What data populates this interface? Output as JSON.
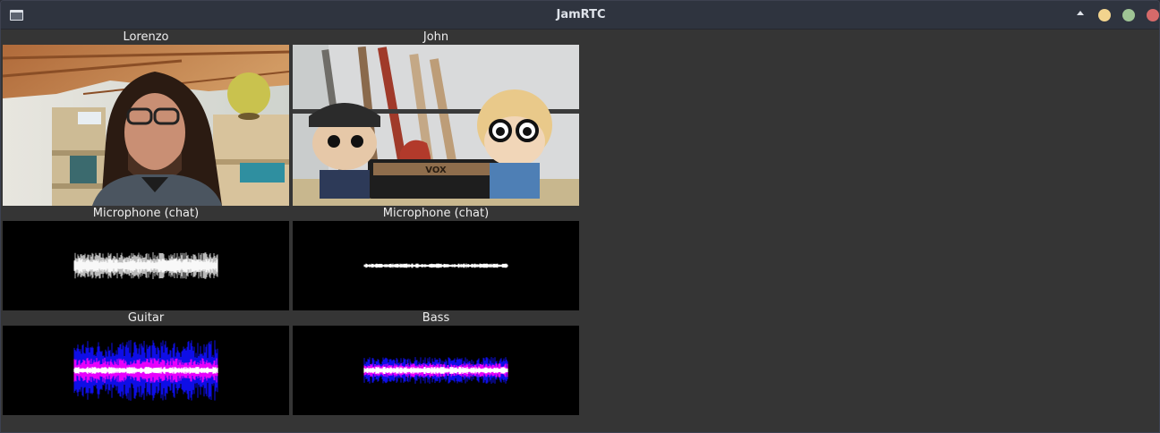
{
  "window": {
    "title": "JamRTC"
  },
  "participants": [
    {
      "name": "Lorenzo",
      "tracks": [
        "Microphone (chat)",
        "Guitar"
      ]
    },
    {
      "name": "John",
      "tracks": [
        "Microphone (chat)",
        "Bass"
      ]
    }
  ],
  "colors": {
    "titlebar": "#2f343f",
    "background": "#353535",
    "waveform_chat": "#ffffff",
    "waveform_instrument_outer": "#1010ff",
    "waveform_instrument_mid": "#ff00ff",
    "waveform_instrument_core": "#ffffff"
  }
}
